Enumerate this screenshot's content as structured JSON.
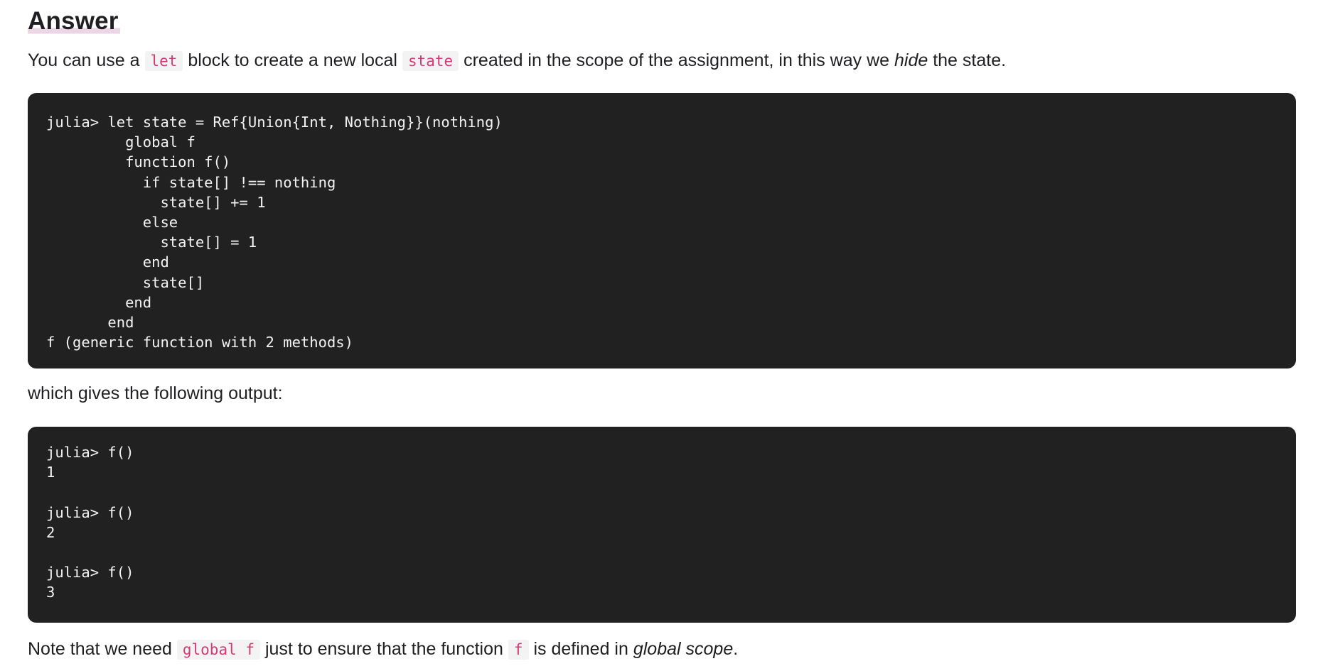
{
  "heading": "Answer",
  "para1": {
    "t1": "You can use a ",
    "code1": "let",
    "t2": " block to create a new local ",
    "code2": "state",
    "t3": " created in the scope of the assignment, in this way we ",
    "em": "hide",
    "t4": " the state."
  },
  "code_block_1": "julia> let state = Ref{Union{Int, Nothing}}(nothing)\n         global f\n         function f()\n           if state[] !== nothing\n             state[] += 1\n           else\n             state[] = 1\n           end\n           state[]\n         end\n       end\nf (generic function with 2 methods)",
  "para2": "which gives the following output:",
  "code_block_2": "julia> f()\n1\n\njulia> f()\n2\n\njulia> f()\n3",
  "para3": {
    "t1": "Note that we need ",
    "code1": "global f",
    "t2": " just to ensure that the function ",
    "code2": "f",
    "t3": " is defined in ",
    "em": "global scope",
    "t4": "."
  },
  "colors": {
    "code_bg": "#212121",
    "code_text": "#f2f2f2",
    "inline_code_text": "#d23a75",
    "inline_code_bg": "#f4f3f3",
    "heading_highlight": "#ecd6e6"
  }
}
